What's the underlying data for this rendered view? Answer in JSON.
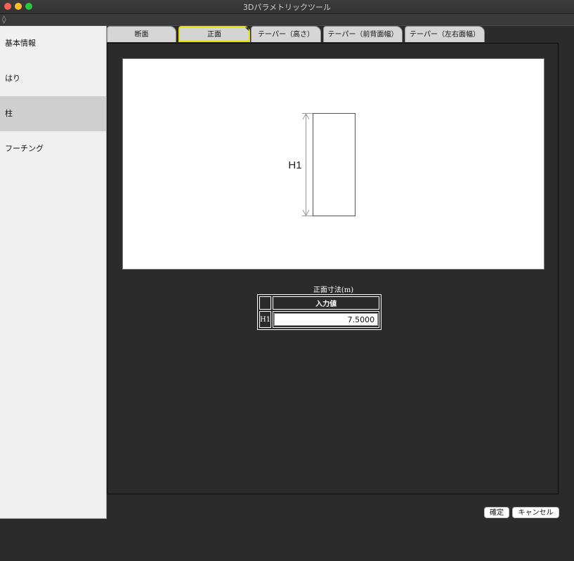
{
  "window": {
    "title": "3Dパラメトリックツール"
  },
  "toolbar": {
    "icon": "diamond-icon"
  },
  "sidebar": {
    "items": [
      {
        "label": "基本情報"
      },
      {
        "label": "はり"
      },
      {
        "label": "柱"
      },
      {
        "label": "フーチング"
      }
    ],
    "selected_index": 2
  },
  "tabs": [
    {
      "label": "断面"
    },
    {
      "label": "正面"
    },
    {
      "label": "テーパー（高さ）"
    },
    {
      "label": "テーパー（前背面幅）"
    },
    {
      "label": "テーパー（左右面幅）"
    }
  ],
  "active_tab_index": 1,
  "diagram": {
    "dimension_label": "H1"
  },
  "dimension_table": {
    "caption": "正面寸法(m)",
    "header": "入力値",
    "rows": [
      {
        "label": "H1",
        "value": "7.5000"
      }
    ]
  },
  "buttons": {
    "ok": "確定",
    "cancel": "キャンセル"
  },
  "colors": {
    "active_tab_outline": "#e6e200",
    "selected_sidebar": "#cfcfcf",
    "panel_bg": "#2b2b2b"
  }
}
